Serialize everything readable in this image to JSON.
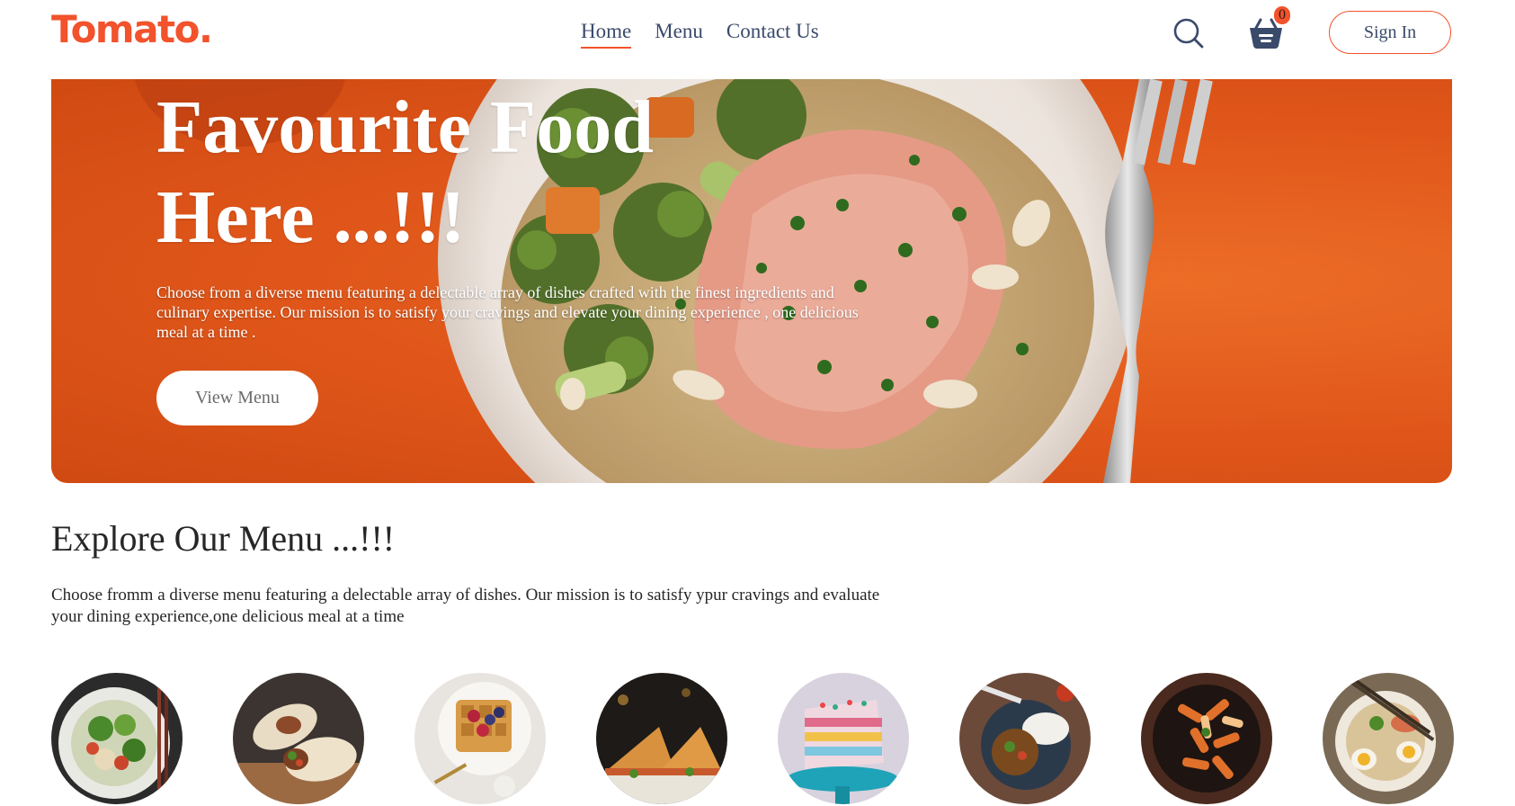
{
  "brand": {
    "logo_text": "Tomato.",
    "accent_color": "#f2522c"
  },
  "nav": {
    "links": [
      {
        "label": "Home",
        "active": true
      },
      {
        "label": "Menu",
        "active": false
      },
      {
        "label": "Contact Us",
        "active": false
      }
    ],
    "search_icon": "search-icon",
    "cart_icon": "basket-icon",
    "cart_count": "0",
    "sign_in_label": "Sign In"
  },
  "hero": {
    "title_line1": "Favourite Food",
    "title_line2": "Here ...!!!",
    "description": "Choose from a diverse menu featuring a delectable array of dishes crafted with the finest ingredients and culinary expertise. Our mission is to satisfy your cravings and elevate your dining experience , one delicious meal at a time .",
    "button_label": "View Menu",
    "background_color": "#e0561a"
  },
  "explore": {
    "title": "Explore Our Menu ...!!!",
    "description": "Choose fromm a diverse menu featuring a delectable array of dishes. Our mission is to satisfy ypur cravings and evaluate your dining experience,one delicious meal at a time"
  }
}
